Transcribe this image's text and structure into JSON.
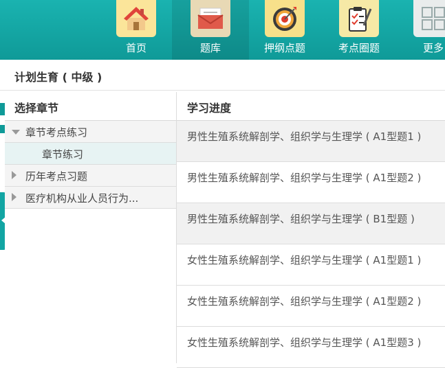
{
  "nav": {
    "items": [
      {
        "label": "首页",
        "icon": "home-icon",
        "icon_bg": "#fbe59a"
      },
      {
        "label": "题库",
        "icon": "envelope-icon",
        "icon_bg": "#e8d9b5"
      },
      {
        "label": "押纲点题",
        "icon": "target-icon",
        "icon_bg": "#f7e08a"
      },
      {
        "label": "考点圈题",
        "icon": "clipboard-icon",
        "icon_bg": "#f6e9a6"
      },
      {
        "label": "更多",
        "icon": "grid-icon",
        "icon_bg": "#e9ecec"
      }
    ],
    "active_index": 1,
    "bar_color": "#12a5a3"
  },
  "page": {
    "title": "计划生育 ( 中级 )"
  },
  "left_panel": {
    "header": "选择章节",
    "items": [
      {
        "label": "章节考点练习",
        "expanded": true,
        "children": [
          "章节练习"
        ]
      },
      {
        "label": "历年考点习题",
        "expanded": false
      },
      {
        "label": "医疗机构从业人员行为..."
      }
    ]
  },
  "right_panel": {
    "header": "学习进度",
    "rows": [
      "男性生殖系统解剖学、组织学与生理学 ( A1型题1 )",
      "男性生殖系统解剖学、组织学与生理学 ( A1型题2 )",
      "男性生殖系统解剖学、组织学与生理学 ( B1型题 )",
      "女性生殖系统解剖学、组织学与生理学 ( A1型题1 )",
      "女性生殖系统解剖学、组织学与生理学 ( A1型题2 )",
      "女性生殖系统解剖学、组织学与生理学 ( A1型题3 )"
    ]
  }
}
